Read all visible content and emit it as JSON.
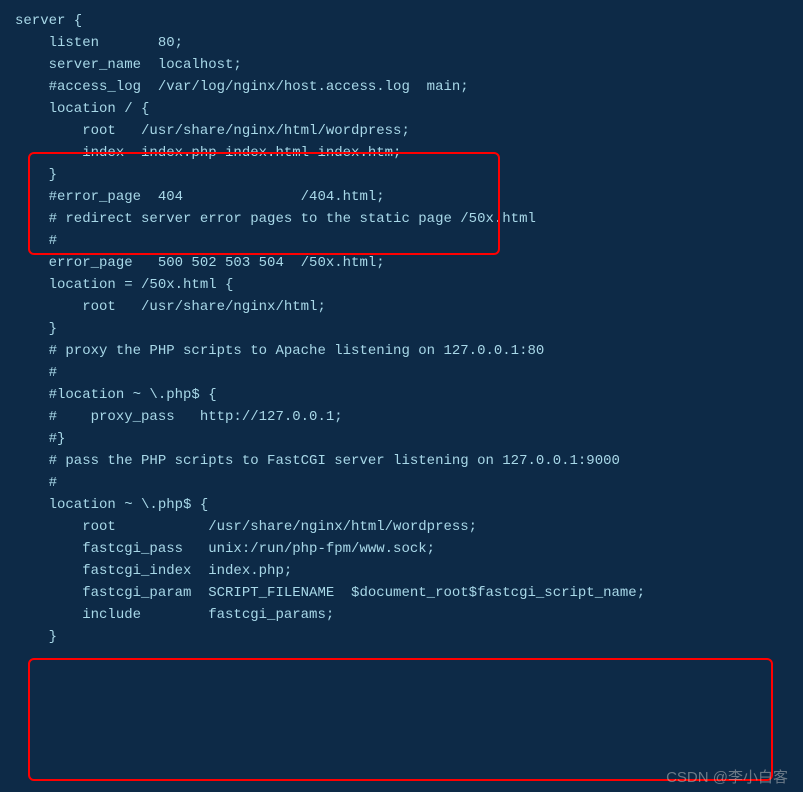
{
  "lines": {
    "l1": "server {",
    "l2": "    listen       80;",
    "l3": "    server_name  localhost;",
    "l4": "",
    "l5": "    #access_log  /var/log/nginx/host.access.log  main;",
    "l6": "",
    "l7": "    location / {",
    "l8": "        root   /usr/share/nginx/html/wordpress;",
    "l9": "        index  index.php index.html index.htm;",
    "l10": "    }",
    "l11": "",
    "l12": "    #error_page  404              /404.html;",
    "l13": "",
    "l14": "    # redirect server error pages to the static page /50x.html",
    "l15": "    #",
    "l16": "    error_page   500 502 503 504  /50x.html;",
    "l17": "    location = /50x.html {",
    "l18": "        root   /usr/share/nginx/html;",
    "l19": "    }",
    "l20": "",
    "l21": "    # proxy the PHP scripts to Apache listening on 127.0.0.1:80",
    "l22": "    #",
    "l23": "    #location ~ \\.php$ {",
    "l24": "    #    proxy_pass   http://127.0.0.1;",
    "l25": "    #}",
    "l26": "",
    "l27": "    # pass the PHP scripts to FastCGI server listening on 127.0.0.1:9000",
    "l28": "    #",
    "l29": "    location ~ \\.php$ {",
    "l30": "        root           /usr/share/nginx/html/wordpress;",
    "l31": "        fastcgi_pass   unix:/run/php-fpm/www.sock;",
    "l32": "        fastcgi_index  index.php;",
    "l33": "        fastcgi_param  SCRIPT_FILENAME  $document_root$fastcgi_script_name;",
    "l34": "        include        fastcgi_params;",
    "l35": "    }"
  },
  "watermark": "CSDN @李小白客"
}
